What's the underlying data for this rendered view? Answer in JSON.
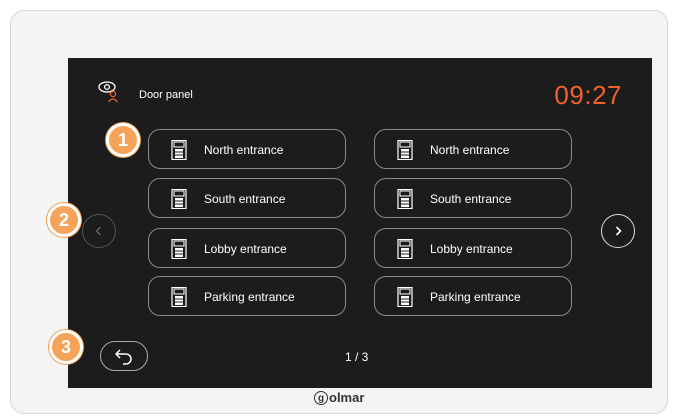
{
  "header": {
    "title": "Door panel",
    "time": "09:27"
  },
  "panels": [
    {
      "label": "North entrance"
    },
    {
      "label": "North entrance"
    },
    {
      "label": "South entrance"
    },
    {
      "label": "South entrance"
    },
    {
      "label": "Lobby entrance"
    },
    {
      "label": "Lobby entrance"
    },
    {
      "label": "Parking entrance"
    },
    {
      "label": "Parking entrance"
    }
  ],
  "pager": {
    "text": "1 / 3"
  },
  "badges": [
    "1",
    "2",
    "3"
  ],
  "brand": {
    "letter": "g",
    "rest": "olmar"
  },
  "colors": {
    "screen": "#1c1c1c",
    "clock": "#f0622c",
    "badge": "#f6a35a"
  }
}
